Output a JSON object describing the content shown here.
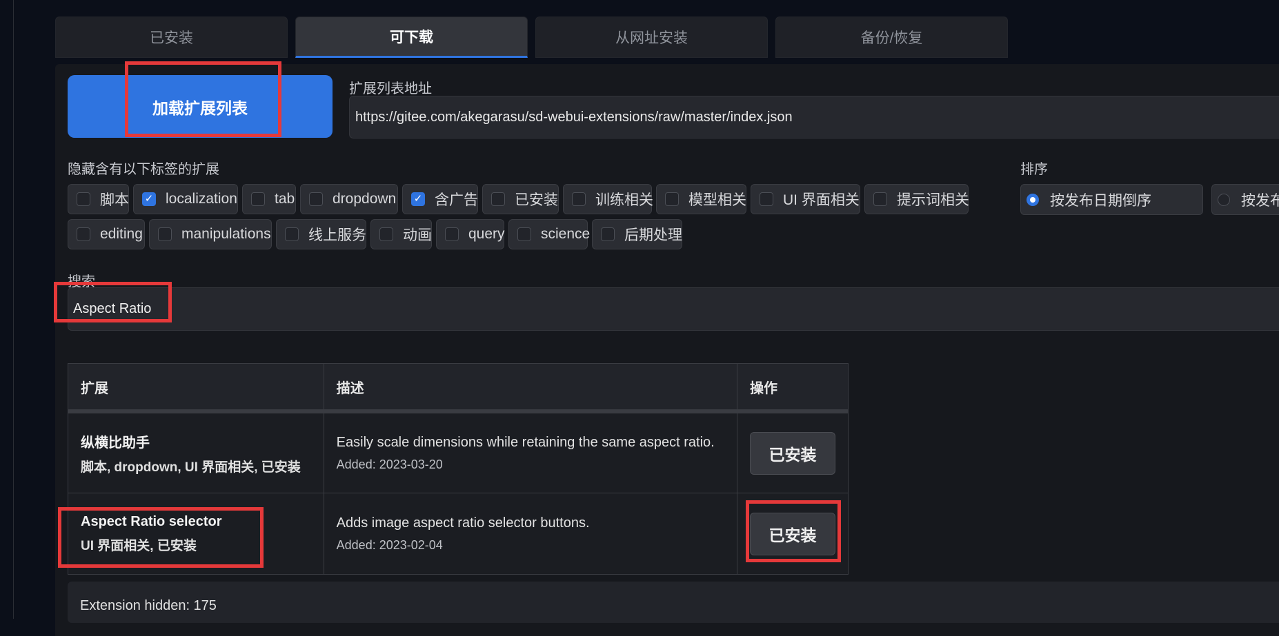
{
  "tabs": [
    "已安装",
    "可下载",
    "从网址安装",
    "备份/恢复"
  ],
  "load_button": "加载扩展列表",
  "url_label": "扩展列表地址",
  "url_value": "https://gitee.com/akegarasu/sd-webui-extensions/raw/master/index.json",
  "hide_label": "隐藏含有以下标签的扩展",
  "tags_row1": [
    {
      "label": "脚本",
      "checked": false
    },
    {
      "label": "localization",
      "checked": true
    },
    {
      "label": "tab",
      "checked": false
    },
    {
      "label": "dropdown",
      "checked": false
    },
    {
      "label": "含广告",
      "checked": true
    },
    {
      "label": "已安装",
      "checked": false
    },
    {
      "label": "训练相关",
      "checked": false
    },
    {
      "label": "模型相关",
      "checked": false
    },
    {
      "label": "UI 界面相关",
      "checked": false
    },
    {
      "label": "提示词相关",
      "checked": false
    }
  ],
  "tags_row2": [
    {
      "label": "editing",
      "checked": false
    },
    {
      "label": "manipulations",
      "checked": false
    },
    {
      "label": "线上服务",
      "checked": false
    },
    {
      "label": "动画",
      "checked": false
    },
    {
      "label": "query",
      "checked": false
    },
    {
      "label": "science",
      "checked": false
    },
    {
      "label": "后期处理",
      "checked": false
    }
  ],
  "sort_label": "排序",
  "sort_options": [
    "按发布日期倒序",
    "按发布"
  ],
  "search_label": "搜索",
  "search_value": "Aspect Ratio",
  "table": {
    "headers": [
      "扩展",
      "描述",
      "操作"
    ],
    "rows": [
      {
        "name": "纵横比助手",
        "tags": "脚本, dropdown, UI 界面相关, 已安装",
        "desc": "Easily scale dimensions while retaining the same aspect ratio.",
        "added": "Added: 2023-03-20",
        "action": "已安装"
      },
      {
        "name": "Aspect Ratio selector",
        "tags": "UI 界面相关, 已安装",
        "desc": "Adds image aspect ratio selector buttons.",
        "added": "Added: 2023-02-04",
        "action": "已安装"
      }
    ]
  },
  "footer_text": "Extension hidden: 175",
  "colors": {
    "accent": "#2f74e0",
    "highlight": "#e5393a"
  }
}
